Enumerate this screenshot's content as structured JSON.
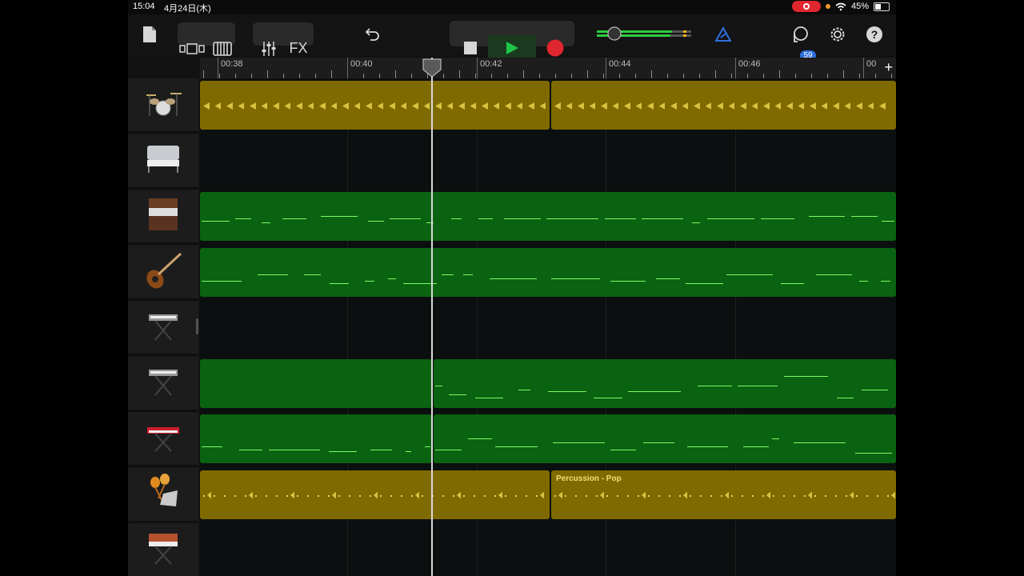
{
  "status": {
    "time": "15:04",
    "date": "4月24日(木)",
    "battery": "45%"
  },
  "toolbar": {
    "fx_label": "FX",
    "notifications_count": "59",
    "colors": {
      "play": "#1ec54a",
      "record": "#e0262e",
      "accent": "#2f6fe0"
    }
  },
  "ruler": {
    "labels": [
      "00:38",
      "00:40",
      "00:42",
      "00:44",
      "00:46",
      "00"
    ]
  },
  "tracks": [
    {
      "id": "drums",
      "icon": "drum-kit-icon",
      "type": "audio"
    },
    {
      "id": "electric-piano",
      "icon": "electric-piano-icon",
      "type": "empty"
    },
    {
      "id": "organ",
      "icon": "organ-icon",
      "type": "midi"
    },
    {
      "id": "bass",
      "icon": "bass-guitar-icon",
      "type": "midi"
    },
    {
      "id": "keyboard-1",
      "icon": "keyboard-stand-icon",
      "type": "empty"
    },
    {
      "id": "keyboard-2",
      "icon": "keyboard-stand-icon",
      "type": "midi"
    },
    {
      "id": "synth-red",
      "icon": "red-synth-icon",
      "type": "midi"
    },
    {
      "id": "percussion",
      "icon": "percussion-icon",
      "type": "audio"
    },
    {
      "id": "synth-vintage",
      "icon": "vintage-synth-icon",
      "type": "empty"
    }
  ],
  "regions": {
    "percussion_label": "Percussion - Pop"
  }
}
